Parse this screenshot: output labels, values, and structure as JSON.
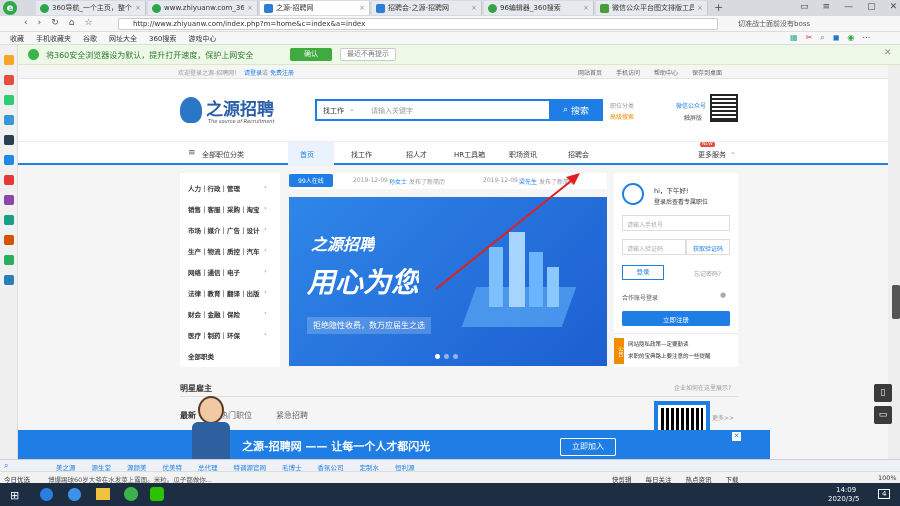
{
  "browser": {
    "tabs": [
      {
        "label": "360导航_一个主页，整个世"
      },
      {
        "label": "www.zhiyuanw.com_360"
      },
      {
        "label": "之源-招聘网"
      },
      {
        "label": "招聘会-之源-招聘网"
      },
      {
        "label": "96编辑器_360搜索"
      },
      {
        "label": "微信公众平台图文排版工具"
      }
    ],
    "url": "http://www.zhiyuanw.com/index.php?m=home&c=index&a=index",
    "search_hint": "切准战士面前没有boss",
    "favorites": [
      "收藏",
      "手机收藏夹",
      "谷歌",
      "网址大全",
      "360搜索",
      "游戏中心"
    ],
    "notify_text": "将360安全浏览器设为默认，提升打开速度，保护上网安全",
    "notify_ok": "确认",
    "notify_never": "最近不再提示"
  },
  "site": {
    "welcome": "欢迎登录之源-招聘网!",
    "login_link": "请登录",
    "or": "或",
    "register_link": "免费注册",
    "top_links": [
      "网站首页",
      "手机访问",
      "帮助中心",
      "保存到桌面"
    ],
    "logo_text": "之源招聘",
    "logo_sub": "The source of Recruitment",
    "search_type": "找工作",
    "search_placeholder": "请输入关键字",
    "search_btn": "搜索",
    "pos_cat": "职位分类",
    "hot_search": "高级搜索",
    "wx_title": "微信公众号",
    "wx_sub": "触屏版",
    "nav_all": "全部职位分类",
    "nav": [
      "首页",
      "找工作",
      "招人才",
      "HR工具箱",
      "职场资讯",
      "招聘会"
    ],
    "nav_more": "更多服务",
    "nav_new_badge": "NEW",
    "categories": [
      "人力｜行政｜管理",
      "销售｜客服｜采购｜淘宝",
      "市场｜媒介｜广告｜设计",
      "生产｜物流｜质控｜汽车",
      "网络｜通信｜电子",
      "法律｜教育｜翻译｜出版",
      "财会｜金融｜保险",
      "医疗｜制药｜环保",
      "全部职类"
    ],
    "online": "99人在线",
    "news": [
      {
        "date": "2019-12-09",
        "who": "孙女士",
        "action": "发布了新简历"
      },
      {
        "date": "2019-12-09",
        "who": "梁先生",
        "action": "发布了新简历"
      }
    ],
    "banner_title": "之源招聘",
    "banner_big": "用心为您",
    "banner_sub": "拒绝隐性收费，数万应届生之选",
    "greet": "hi，下午好!",
    "greet_sub": "登录后查看专属职位",
    "phone_ph": "请输入手机号",
    "code_ph": "请输入验证码",
    "get_code": "获取验证码",
    "login_btn": "登录",
    "forgot": "忘记密码?",
    "partner": "合作账号登录",
    "register_btn": "立即注册",
    "notice_label": "公告",
    "notices": [
      "网站隐私政策—定要勤读",
      "求职的宝典路上要注意的一些提醒"
    ],
    "stars_title": "明星雇主",
    "stars_link": "企业如何在这里展示?",
    "tabs2": [
      "最新",
      "热门职位",
      "紧急招聘"
    ],
    "more": "更多>>",
    "promo_title": "之源-招聘网 —— 让每一个人才都闪光",
    "promo_btn": "立即加入"
  },
  "links_bar": [
    "美之源",
    "源生堂",
    "源颜美",
    "优美特",
    "总代理",
    "特调源官网",
    "毛博士",
    "香氛公司",
    "定制水",
    "恒利源"
  ],
  "status": {
    "left": "今日优选",
    "news": "博爆踢球60岁大爷在水发菜上露面。米粒。瓜子都做你...",
    "items": [
      "快剪辑",
      "每日关注",
      "热点资讯",
      "下载"
    ],
    "zoom": "100%"
  },
  "taskbar": {
    "time": "14:09",
    "date": "2020/3/5",
    "notif": "4"
  }
}
